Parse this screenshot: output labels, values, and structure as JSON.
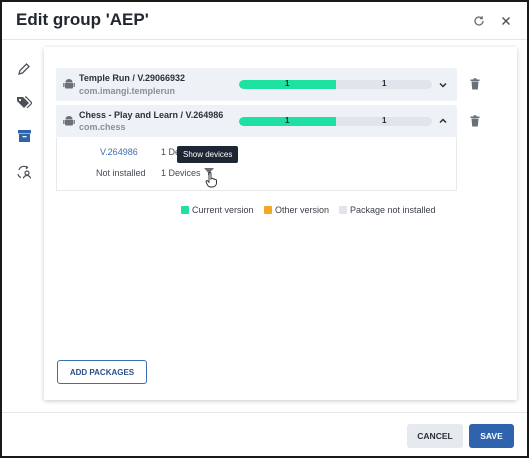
{
  "dialog": {
    "title": "Edit group 'AEP'"
  },
  "packages": [
    {
      "name": "Temple Run / V.29066932",
      "id": "com.imangi.templerun",
      "bar": {
        "current": 1,
        "not_installed": 1,
        "current_fraction": 0.5
      }
    },
    {
      "name": "Chess - Play and Learn / V.264986",
      "id": "com.chess",
      "bar": {
        "current": 1,
        "not_installed": 1,
        "current_fraction": 0.5
      },
      "details": [
        {
          "version": "V.264986",
          "devices": "1 Devices"
        },
        {
          "version": "Not installed",
          "devices": "1 Devices"
        }
      ]
    }
  ],
  "tooltip": "Show devices",
  "legend": [
    {
      "label": "Current version",
      "color": "#1ee0a0"
    },
    {
      "label": "Other version",
      "color": "#f5a623"
    },
    {
      "label": "Package not installed",
      "color": "#e1e4ea"
    }
  ],
  "buttons": {
    "add_packages": "ADD PACKAGES",
    "cancel": "CANCEL",
    "save": "SAVE"
  },
  "icons": [
    "refresh-icon",
    "close-icon",
    "pencil-icon",
    "tags-icon",
    "archive-icon",
    "sync-user-icon",
    "android-icon",
    "chevron-down-icon",
    "chevron-up-icon",
    "trash-icon"
  ]
}
